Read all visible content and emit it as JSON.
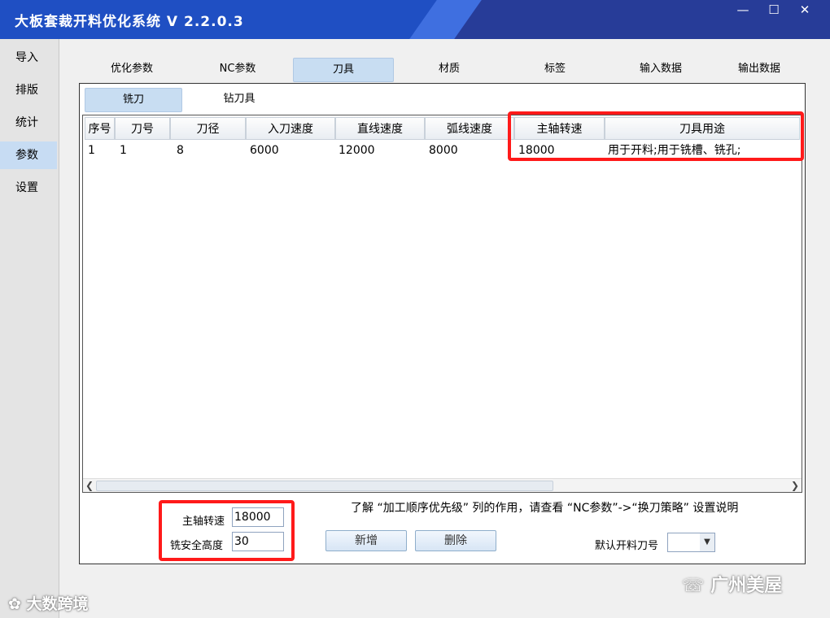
{
  "window": {
    "title": "大板套裁开料优化系统 V 2.2.0.3",
    "controls": {
      "minimize": "—",
      "maximize": "☐",
      "close": "✕"
    }
  },
  "sidebar": {
    "items": [
      {
        "label": "导入"
      },
      {
        "label": "排版"
      },
      {
        "label": "统计"
      },
      {
        "label": "参数"
      },
      {
        "label": "设置"
      }
    ]
  },
  "tabs": [
    {
      "label": "优化参数"
    },
    {
      "label": "NC参数"
    },
    {
      "label": "刀具"
    },
    {
      "label": "材质"
    },
    {
      "label": "标签"
    },
    {
      "label": "输入数据"
    },
    {
      "label": "输出数据"
    }
  ],
  "subtabs": [
    {
      "label": "铣刀"
    },
    {
      "label": "钻刀具"
    }
  ],
  "table": {
    "headers": [
      "序号",
      "刀号",
      "刀径",
      "入刀速度",
      "直线速度",
      "弧线速度",
      "主轴转速",
      "刀具用途"
    ],
    "rows": [
      [
        "1",
        "1",
        "8",
        "6000",
        "12000",
        "8000",
        "18000",
        "用于开料;用于铣槽、铣孔;"
      ]
    ]
  },
  "footer": {
    "hint": "了解 “加工顺序优先级” 列的作用，请查看 “NC参数”->“换刀策略” 设置说明",
    "spindle_label": "主轴转速",
    "spindle_value": "18000",
    "safe_height_label": "铣安全高度",
    "safe_height_value": "30",
    "add_button": "新增",
    "delete_button": "删除",
    "default_tool_label": "默认开料刀号",
    "default_tool_value": ""
  },
  "watermarks": {
    "left": "大数跨境",
    "right": "广州美屋"
  },
  "colors": {
    "titlebar": "#1f4fc3",
    "highlight": "#ff1a1a",
    "active_tab": "#c8ddf2"
  }
}
